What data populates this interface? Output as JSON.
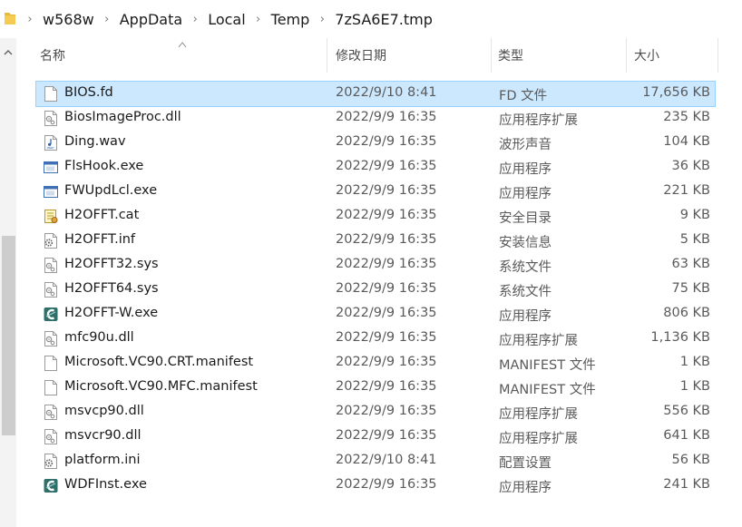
{
  "breadcrumb": [
    "w568w",
    "AppData",
    "Local",
    "Temp",
    "7zSA6E7.tmp"
  ],
  "columns": {
    "name": "名称",
    "modified": "修改日期",
    "type": "类型",
    "size": "大小"
  },
  "files": [
    {
      "name": "BIOS.fd",
      "modified": "2022/9/10 8:41",
      "type": "FD 文件",
      "size": "17,656 KB",
      "icon": "generic-file-icon"
    },
    {
      "name": "BiosImageProc.dll",
      "modified": "2022/9/9 16:35",
      "type": "应用程序扩展",
      "size": "235 KB",
      "icon": "dll-file-icon"
    },
    {
      "name": "Ding.wav",
      "modified": "2022/9/9 16:35",
      "type": "波形声音",
      "size": "104 KB",
      "icon": "audio-file-icon"
    },
    {
      "name": "FlsHook.exe",
      "modified": "2022/9/9 16:35",
      "type": "应用程序",
      "size": "36 KB",
      "icon": "exe-window-icon"
    },
    {
      "name": "FWUpdLcl.exe",
      "modified": "2022/9/9 16:35",
      "type": "应用程序",
      "size": "221 KB",
      "icon": "exe-window-icon"
    },
    {
      "name": "H2OFFT.cat",
      "modified": "2022/9/9 16:35",
      "type": "安全目录",
      "size": "9 KB",
      "icon": "catalog-file-icon"
    },
    {
      "name": "H2OFFT.inf",
      "modified": "2022/9/9 16:35",
      "type": "安装信息",
      "size": "5 KB",
      "icon": "settings-file-icon"
    },
    {
      "name": "H2OFFT32.sys",
      "modified": "2022/9/9 16:35",
      "type": "系统文件",
      "size": "63 KB",
      "icon": "dll-file-icon"
    },
    {
      "name": "H2OFFT64.sys",
      "modified": "2022/9/9 16:35",
      "type": "系统文件",
      "size": "75 KB",
      "icon": "dll-file-icon"
    },
    {
      "name": "H2OFFT-W.exe",
      "modified": "2022/9/9 16:35",
      "type": "应用程序",
      "size": "806 KB",
      "icon": "insyde-app-icon"
    },
    {
      "name": "mfc90u.dll",
      "modified": "2022/9/9 16:35",
      "type": "应用程序扩展",
      "size": "1,136 KB",
      "icon": "dll-file-icon"
    },
    {
      "name": "Microsoft.VC90.CRT.manifest",
      "modified": "2022/9/9 16:35",
      "type": "MANIFEST 文件",
      "size": "1 KB",
      "icon": "generic-file-icon"
    },
    {
      "name": "Microsoft.VC90.MFC.manifest",
      "modified": "2022/9/9 16:35",
      "type": "MANIFEST 文件",
      "size": "1 KB",
      "icon": "generic-file-icon"
    },
    {
      "name": "msvcp90.dll",
      "modified": "2022/9/9 16:35",
      "type": "应用程序扩展",
      "size": "556 KB",
      "icon": "dll-file-icon"
    },
    {
      "name": "msvcr90.dll",
      "modified": "2022/9/9 16:35",
      "type": "应用程序扩展",
      "size": "641 KB",
      "icon": "dll-file-icon"
    },
    {
      "name": "platform.ini",
      "modified": "2022/9/10 8:41",
      "type": "配置设置",
      "size": "56 KB",
      "icon": "settings-file-icon"
    },
    {
      "name": "WDFInst.exe",
      "modified": "2022/9/9 16:35",
      "type": "应用程序",
      "size": "241 KB",
      "icon": "insyde-app-icon"
    }
  ],
  "selected_index": 0,
  "colors": {
    "selection": "#cce8ff",
    "selection_border": "#99d1ff",
    "folder": "#e8b93b"
  }
}
